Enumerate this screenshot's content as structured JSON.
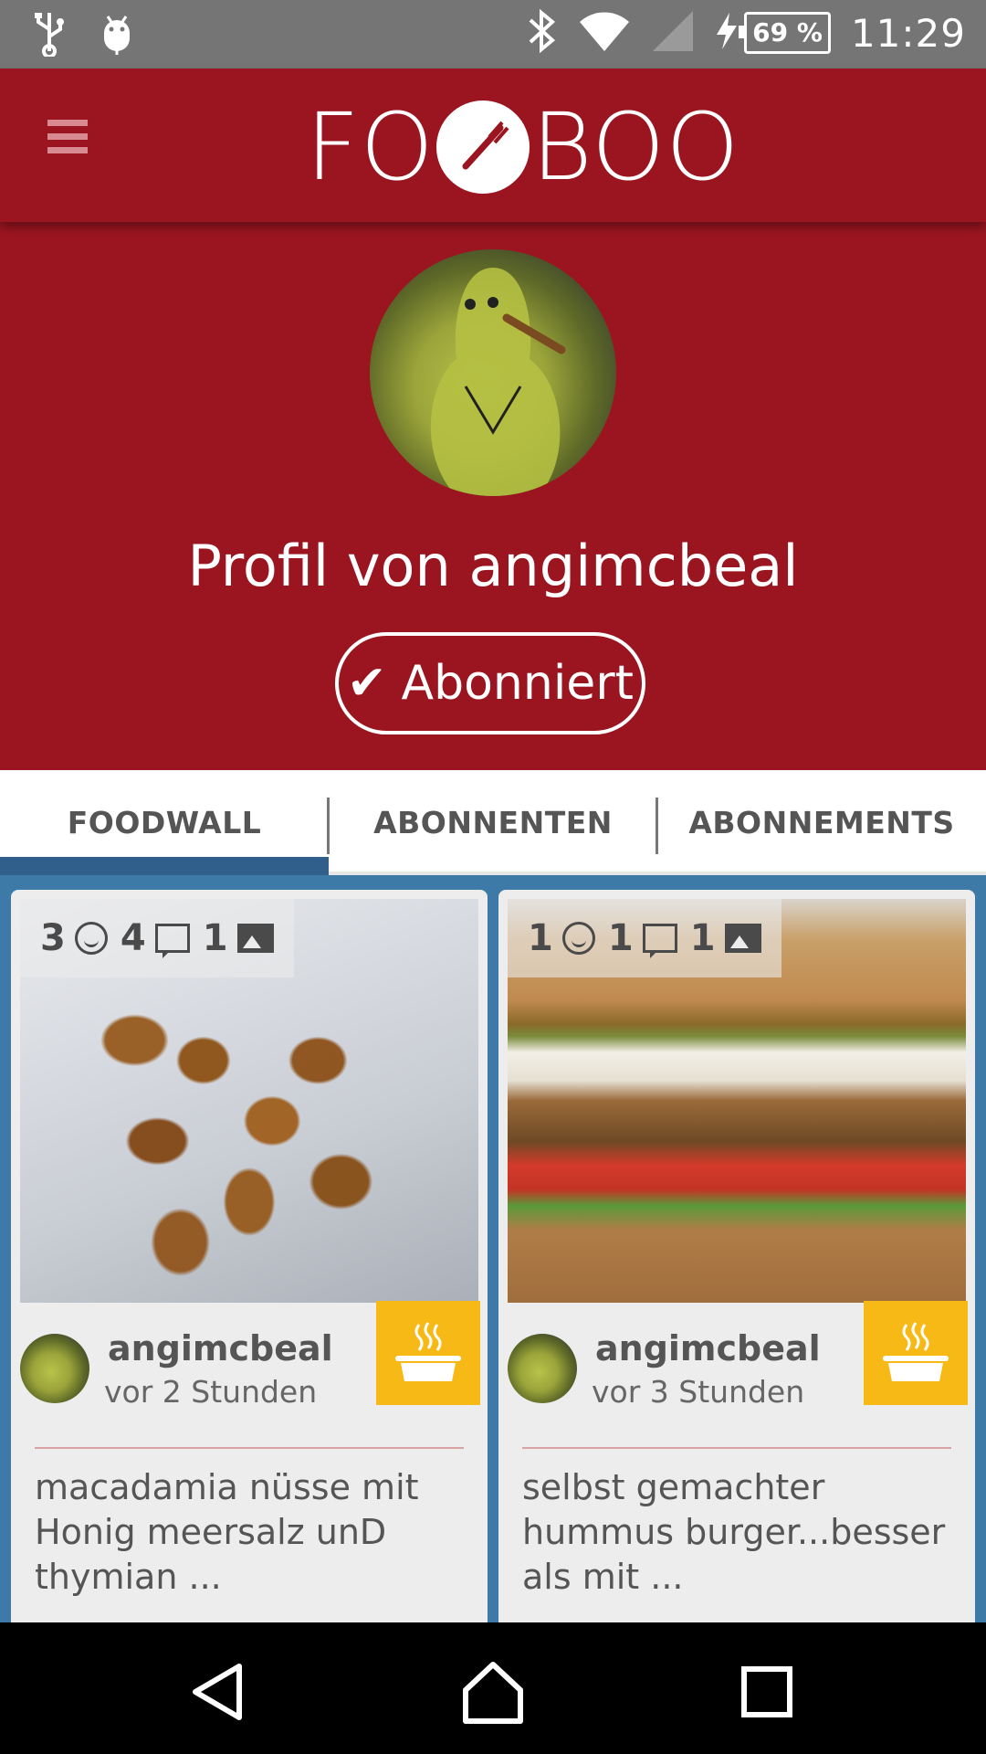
{
  "status_bar": {
    "left_icons": [
      "usb-icon",
      "android-debug-icon"
    ],
    "right_icons": [
      "bluetooth-icon",
      "wifi-icon",
      "cell-signal-icon",
      "charging-icon"
    ],
    "battery": "69 %",
    "time": "11:29"
  },
  "app_bar": {
    "logo_left": "FO",
    "logo_right": "BOO",
    "brand_color": "#9b1520"
  },
  "profile": {
    "title": "Profil von angimcbeal",
    "subscribe_label": "Abonniert"
  },
  "tabs": [
    {
      "label": "FOODWALL",
      "active": true
    },
    {
      "label": "ABONNENTEN",
      "active": false
    },
    {
      "label": "ABONNEMENTS",
      "active": false
    }
  ],
  "posts": [
    {
      "stats": {
        "smiles": "3",
        "comments": "4",
        "images": "1"
      },
      "author": "angimcbeal",
      "time": "vor 2 Stunden",
      "description": "macadamia  nüsse mit Honig meersalz unD thymian ..."
    },
    {
      "stats": {
        "smiles": "1",
        "comments": "1",
        "images": "1"
      },
      "author": "angimcbeal",
      "time": "vor 3 Stunden",
      "description": "selbst gemachter hummus burger...besser als mit ..."
    }
  ],
  "colors": {
    "accent": "#9b1520",
    "feed_background": "#3e7aa8",
    "badge": "#f7b916"
  }
}
